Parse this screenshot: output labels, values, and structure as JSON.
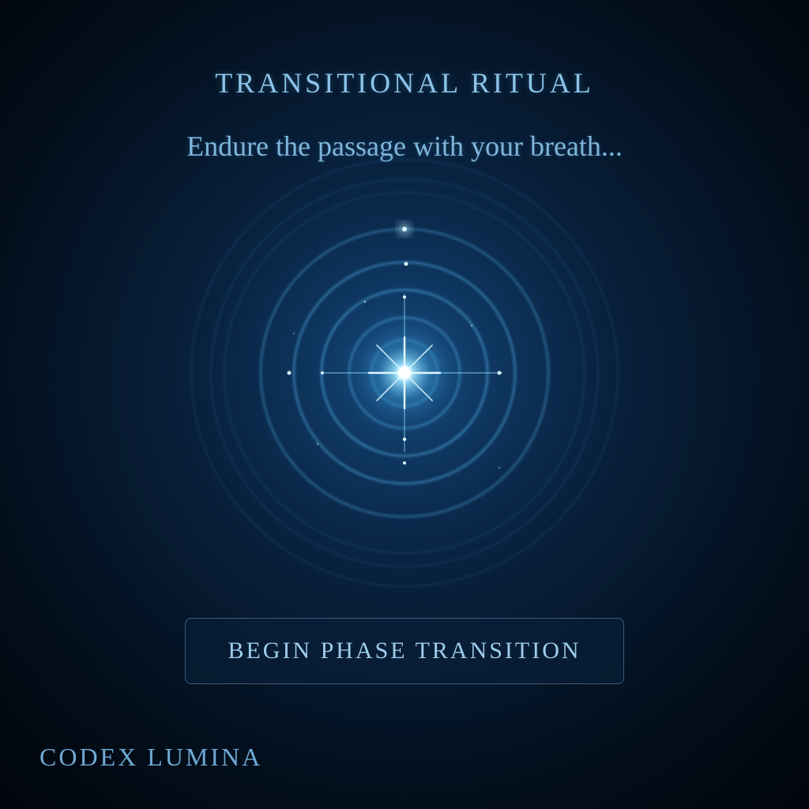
{
  "header": {
    "title": "TRANSITIONAL RITUAL",
    "subtitle": "Endure the passage with your breath..."
  },
  "emblem": {
    "icon": "concentric-rings-star-icon"
  },
  "actions": {
    "begin_label": "BEGIN PHASE TRANSITION"
  },
  "footer": {
    "brand": "CODEX LUMINA"
  },
  "colors": {
    "background": "#061a31",
    "accent": "#8cc4e8",
    "glow": "#bfefff",
    "ring": "#4aa3dc"
  }
}
